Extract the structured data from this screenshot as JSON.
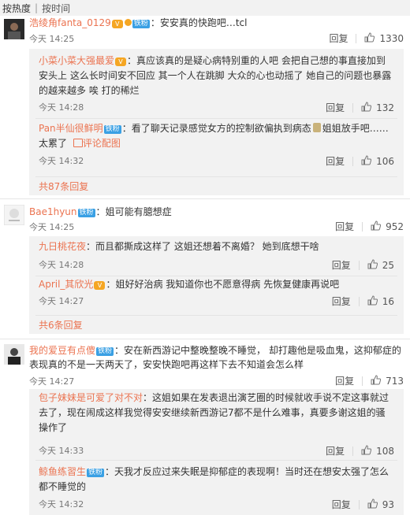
{
  "sort": {
    "hot": "按热度",
    "sep": "|",
    "time": "按时间"
  },
  "comments": [
    {
      "user": "浩绫角fanta_0129",
      "text": "安安真的快跑吧…tcl",
      "time": "今天 14:25",
      "reply_label": "回复",
      "likes": "1330",
      "replies": [
        {
          "user": "小菜小菜大强最爱",
          "text": "真应该真的是疑心病特别重的人吧 会把自己想的事直接加到安头上 这么长时间安不回应 其一个人在跳脚 大众的心也动摇了 她自己的问题也暴露的越来越多 唉 打的稀烂",
          "time": "今天 14:28",
          "reply_label": "回复",
          "likes": "132"
        },
        {
          "user": "Pan半仙很鲜明",
          "text": "看了聊天记录感觉女方的控制欲偏执到病态",
          "text2": "姐姐放手吧……太累了",
          "pic": "评论配图",
          "time": "今天 14:32",
          "reply_label": "回复",
          "likes": "106"
        }
      ],
      "more": "共87条回复"
    },
    {
      "user": "Bae1hyun",
      "text": "姐可能有臆想症",
      "time": "今天 14:25",
      "reply_label": "回复",
      "likes": "952",
      "replies": [
        {
          "user": "九日桃花夜",
          "text": "而且都撕成这样了 这姐还想着不离婚？ 她到底想干啥",
          "time": "今天 14:28",
          "reply_label": "回复",
          "likes": "25"
        },
        {
          "user": "April_其欣光",
          "text": "姐好好治病 我知道你也不愿意得病 先恢复健康再说吧",
          "time": "今天 14:27",
          "reply_label": "回复",
          "likes": "16"
        }
      ],
      "more": "共6条回复"
    },
    {
      "user": "我的爱豆有点傻",
      "text": "安在新西游记中整晚整晚不睡觉， 却打趣他是吸血鬼，这抑郁症的表现真的不是一天两天了，安安快跑吧再这样下去不知道会怎么样",
      "time": "今天 14:27",
      "reply_label": "回复",
      "likes": "713",
      "replies": [
        {
          "user": "包子妹妹是可爱了对不对",
          "text": "这姐如果在发表退出演艺圈的时候就收手说不定这事就过去了，现在闹成这样我觉得安安继续新西游记7都不是什么难事，真要多谢这姐的骚操作了",
          "time": "今天 14:33",
          "reply_label": "回复",
          "likes": "108"
        },
        {
          "user": "鲸鱼练習生",
          "text": "天我才反应过来失眠是抑郁症的表现啊！当时还在想安太强了怎么都不睡觉的",
          "time": "今天 14:32",
          "reply_label": "回复",
          "likes": "93"
        }
      ]
    }
  ],
  "badges": {
    "member": "铁粉",
    "vip": "V"
  },
  "colors": {
    "username": "#eb7350",
    "badge": "#3aa0e4",
    "reply_bg": "#f2f2f2"
  }
}
